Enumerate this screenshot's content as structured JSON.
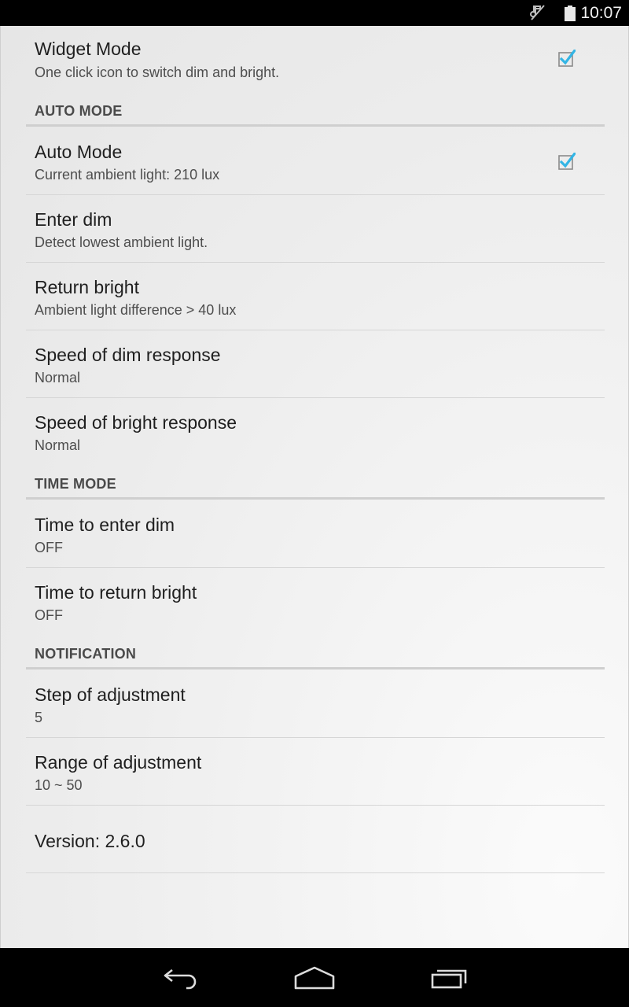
{
  "status_bar": {
    "time": "10:07",
    "icons": [
      "mute-icon",
      "battery-icon"
    ]
  },
  "colors": {
    "check_accent": "#33b5e5",
    "category_text": "#4a4a4a"
  },
  "preferences": {
    "widget_mode": {
      "title": "Widget Mode",
      "summary": "One click icon to switch dim and bright.",
      "checked": true
    },
    "auto_mode_header": "AUTO MODE",
    "auto_mode": {
      "title": "Auto Mode",
      "summary": "Current ambient light: 210 lux",
      "checked": true
    },
    "enter_dim": {
      "title": "Enter dim",
      "summary": "Detect lowest ambient light."
    },
    "return_bright": {
      "title": "Return bright",
      "summary": "Ambient light difference > 40 lux"
    },
    "speed_dim": {
      "title": "Speed of dim response",
      "summary": "Normal"
    },
    "speed_bright": {
      "title": "Speed of bright response",
      "summary": "Normal"
    },
    "time_mode_header": "TIME MODE",
    "time_enter_dim": {
      "title": "Time to enter dim",
      "summary": "OFF"
    },
    "time_return_bright": {
      "title": "Time to return bright",
      "summary": "OFF"
    },
    "notification_header": "NOTIFICATION",
    "step_adjust": {
      "title": "Step of adjustment",
      "summary": "5"
    },
    "range_adjust": {
      "title": "Range of adjustment",
      "summary": "10 ~ 50"
    },
    "version": {
      "title": "Version: 2.6.0"
    }
  },
  "nav_bar": {
    "buttons": [
      "back-icon",
      "home-icon",
      "recents-icon"
    ]
  }
}
